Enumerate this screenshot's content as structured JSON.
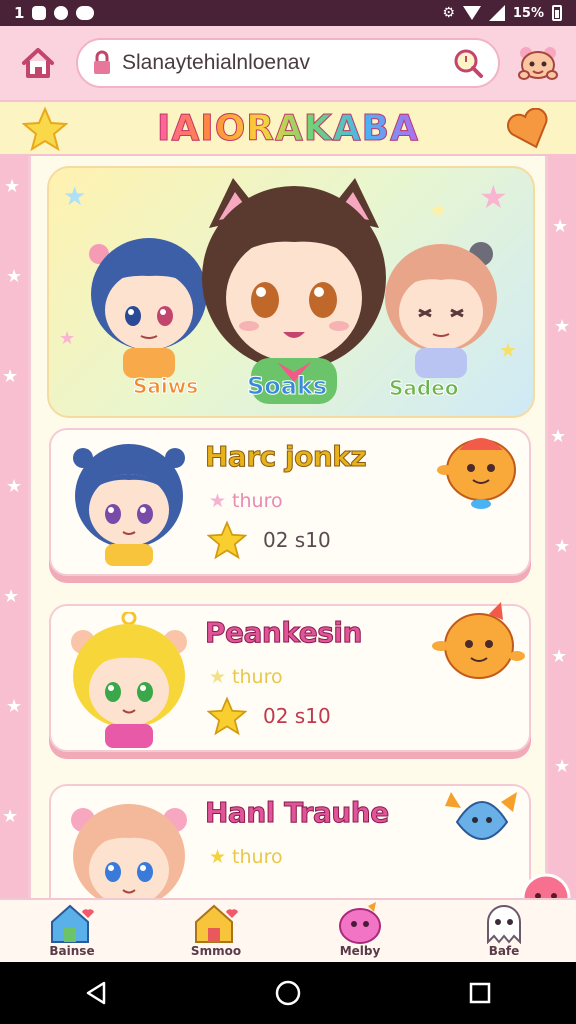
{
  "status_bar": {
    "time": "1",
    "battery_text": "15%"
  },
  "browser": {
    "url": "Slanaytehialnloenav"
  },
  "banner": {
    "title": "IAIORAKABA"
  },
  "hero": {
    "labels": [
      "Saiws",
      "Soaks",
      "Sadeo"
    ]
  },
  "cards": [
    {
      "title": "Harc jonkz",
      "subtitle": "thuro",
      "meta": "02 s10",
      "title_color": "#e8b21a",
      "meta_color": "#5a4a52"
    },
    {
      "title": "Peankesin",
      "subtitle": "thuro",
      "meta": "02 s10",
      "title_color": "#e0559a",
      "meta_color": "#c0394f"
    },
    {
      "title": "Hanl Trauhe",
      "subtitle": "thuro",
      "meta": "",
      "title_color": "#e0559a",
      "meta_color": "#5a4a52"
    }
  ],
  "bottom_nav": [
    {
      "label": "Bainse",
      "icon": "house-heart-icon"
    },
    {
      "label": "Smmoo",
      "icon": "house-heart-icon"
    },
    {
      "label": "Melby",
      "icon": "slime-icon"
    },
    {
      "label": "Bafe",
      "icon": "ghost-icon"
    }
  ],
  "colors": {
    "accent_pink": "#f7c6d4",
    "panel_cream": "#fffbea",
    "card_shadow": "#f2a9b8",
    "star_yellow": "#f9cf2f"
  }
}
